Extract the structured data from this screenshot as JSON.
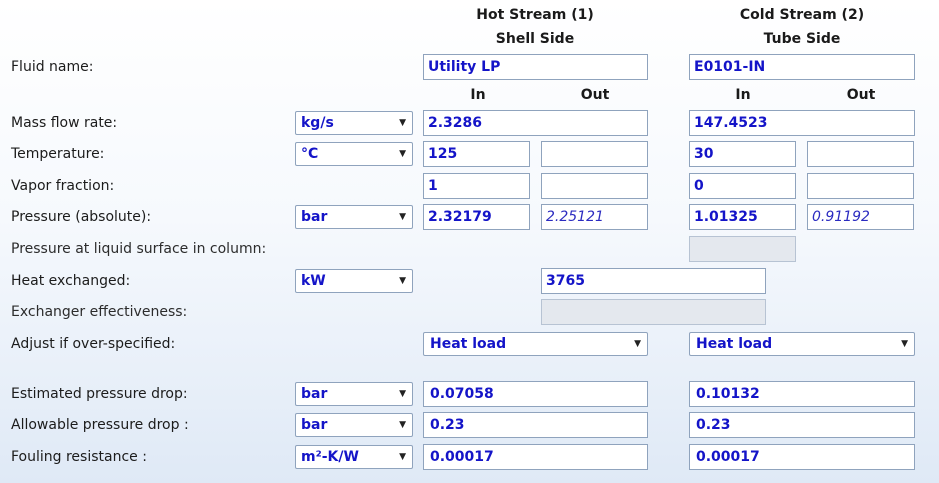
{
  "headers": {
    "hot": {
      "title": "Hot Stream (1)",
      "side": "Shell Side"
    },
    "cold": {
      "title": "Cold Stream (2)",
      "side": "Tube Side"
    },
    "in_label": "In",
    "out_label": "Out"
  },
  "rows": {
    "fluid_name": {
      "label": "Fluid name:",
      "hot": "Utility LP",
      "cold": "E0101-IN"
    },
    "mass_flow": {
      "label": "Mass flow rate:",
      "unit": "kg/s",
      "hot": "2.3286",
      "cold": "147.4523"
    },
    "temperature": {
      "label": "Temperature:",
      "unit": "°C",
      "hot_in": "125",
      "hot_out": "",
      "cold_in": "30",
      "cold_out": ""
    },
    "vapor_fraction": {
      "label": "Vapor fraction:",
      "hot_in": "1",
      "hot_out": "",
      "cold_in": "0",
      "cold_out": ""
    },
    "pressure": {
      "label": "Pressure (absolute):",
      "unit": "bar",
      "hot_in": "2.32179",
      "hot_out": "2.25121",
      "cold_in": "1.01325",
      "cold_out": "0.91192"
    },
    "pressure_liquid": {
      "label": "Pressure at liquid surface in column:",
      "cold": ""
    },
    "heat_exchanged": {
      "label": "Heat exchanged:",
      "unit": "kW",
      "value": "3765"
    },
    "effectiveness": {
      "label": "Exchanger effectiveness:",
      "value": ""
    },
    "adjust": {
      "label": "Adjust if over-specified:",
      "hot": "Heat load",
      "cold": "Heat load"
    },
    "est_dp": {
      "label": "Estimated pressure drop:",
      "unit": "bar",
      "hot": "0.07058",
      "cold": "0.10132"
    },
    "allow_dp": {
      "label": "Allowable pressure drop :",
      "unit": "bar",
      "hot": "0.23",
      "cold": "0.23"
    },
    "fouling": {
      "label": "Fouling resistance :",
      "unit": "m²-K/W",
      "hot": "0.00017",
      "cold": "0.00017"
    }
  },
  "icons": {
    "dropdown": "chevron-down-icon"
  },
  "colors": {
    "value_text": "#1414c8",
    "field_border": "#8fa3bd",
    "disabled_field": "#e4e8ee"
  }
}
